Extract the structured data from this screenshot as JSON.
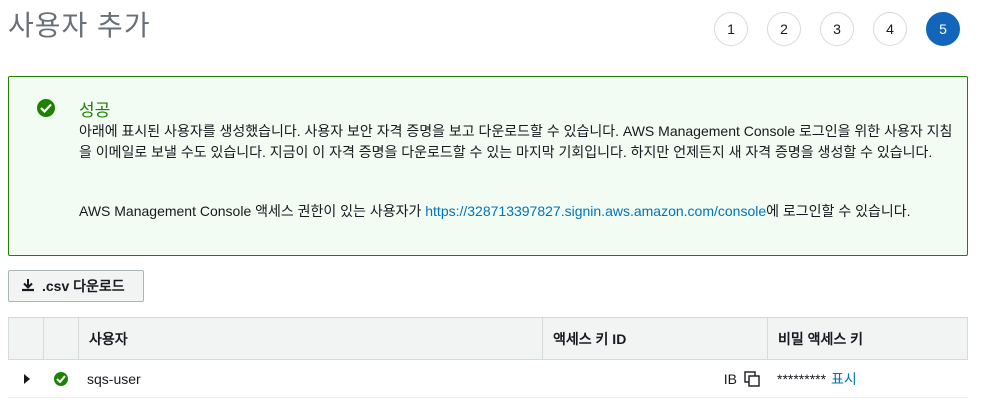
{
  "page": {
    "title": "사용자 추가"
  },
  "steps": [
    "1",
    "2",
    "3",
    "4",
    "5"
  ],
  "active_step": "5",
  "alert": {
    "title": "성공",
    "body": "아래에 표시된 사용자를 생성했습니다. 사용자 보안 자격 증명을 보고 다운로드할 수 있습니다. AWS Management Console 로그인을 위한 사용자 지침을 이메일로 보낼 수도 있습니다. 지금이 이 자격 증명을 다운로드할 수 있는 마지막 기회입니다. 하지만 언제든지 새 자격 증명을 생성할 수 있습니다.",
    "console_prefix": "AWS Management Console 액세스 권한이 있는 사용자가 ",
    "console_link": "https://328713397827.signin.aws.amazon.com/console",
    "console_suffix": "에 로그인할 수 있습니다.",
    "color": "#1d8102"
  },
  "toolbar": {
    "csv_label": ".csv 다운로드",
    "csv_icon": "download-icon"
  },
  "table": {
    "headers": {
      "user": "사용자",
      "access_key": "액세스 키 ID",
      "secret": "비밀 액세스 키"
    },
    "rows": [
      {
        "user": "sqs-user",
        "access_key": "IB",
        "secret_masked": "*********",
        "show_label": "표시"
      }
    ]
  }
}
